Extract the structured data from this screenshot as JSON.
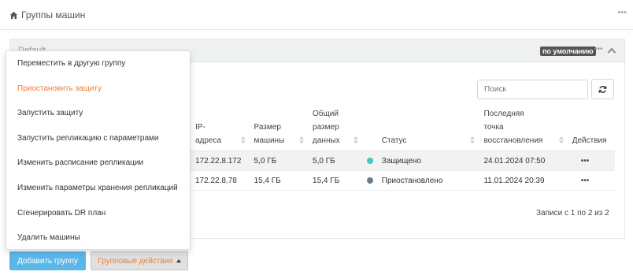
{
  "header": {
    "title": "Группы машин",
    "menu_icon": "ellipsis-icon",
    "home_icon": "home-icon"
  },
  "panel": {
    "group_name": "Default",
    "default_badge": "по умолчанию",
    "menu_icon": "ellipsis-icon",
    "collapse_icon": "chevron-up-icon"
  },
  "search": {
    "placeholder": "Поиск",
    "refresh_icon": "refresh-icon"
  },
  "table": {
    "columns": [
      "IP-\nадреса",
      "Размер машины",
      "Общий размер данных",
      "",
      "Статус",
      "Последняя точка восстановления",
      "Действия"
    ],
    "col_ip_1": "IP-",
    "col_ip_2": "адреса",
    "col_size_1": "Размер",
    "col_size_2": "машины",
    "col_total_1": "Общий",
    "col_total_2": "размер",
    "col_total_3": "данных",
    "col_status": "Статус",
    "col_last_1": "Последняя",
    "col_last_2": "точка",
    "col_last_3": "восстановления",
    "col_actions": "Действия",
    "rows": [
      {
        "ip": "172.22.8.172",
        "size": "5,0 ГБ",
        "total": "5,0 ГБ",
        "status_color": "#3ec9c0",
        "status": "Защищено",
        "last": "24.01.2024 07:50",
        "actions": "•••"
      },
      {
        "ip": "172.22.8.78",
        "size": "15,4 ГБ",
        "total": "15,4 ГБ",
        "status_color": "#6e7d8e",
        "status": "Приостановлено",
        "last": "11.01.2024 20:39",
        "actions": "•••"
      }
    ],
    "records_info": "Записи с 1 по 2 из 2"
  },
  "footer": {
    "add_label": "Добавить группу",
    "group_actions_label": "Групповые действия"
  },
  "menu": {
    "items": [
      "Переместить в другую группу",
      "Приостановить защиту",
      "Запустить защиту",
      "Запустить репликацию с параметрами",
      "Изменить расписание репликации",
      "Изменить параметры хранения репликаций",
      "Сгенерировать DR план",
      "Удалить машины"
    ],
    "highlight_color": "#e9803f"
  }
}
